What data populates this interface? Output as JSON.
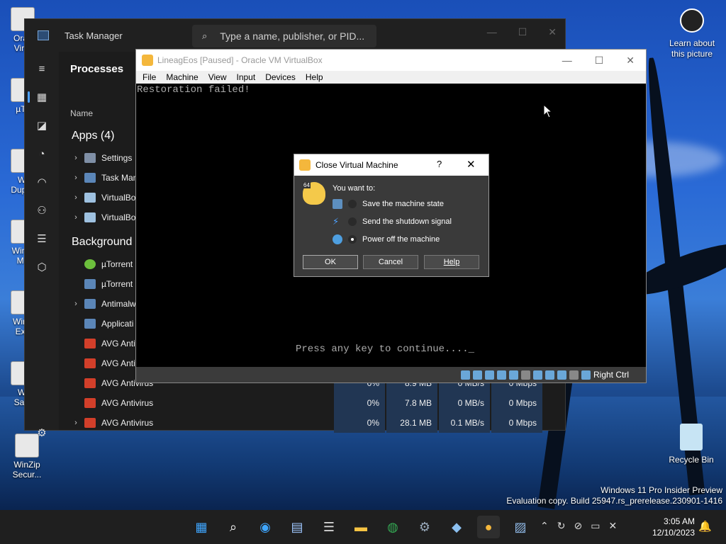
{
  "desktop": {
    "left_icons": [
      {
        "label": "Orac\nVirtu"
      },
      {
        "label": "µTo"
      },
      {
        "label": "Wi\nDuplic"
      },
      {
        "label": "WinZi\nMa"
      },
      {
        "label": "WinZ\nExp"
      },
      {
        "label": "Wi\nSafe"
      },
      {
        "label": "WinZip\nSecur..."
      }
    ],
    "learn_about": "Learn about\nthis picture",
    "recycle_bin": "Recycle Bin",
    "watermark_line1": "Windows 11 Pro Insider Preview",
    "watermark_line2": "Evaluation copy. Build 25947.rs_prerelease.230901-1416"
  },
  "task_manager": {
    "title": "Task Manager",
    "search_placeholder": "Type a name, publisher, or PID...",
    "page_title": "Processes",
    "col_name": "Name",
    "apps_header": "Apps (4)",
    "background_header": "Background p",
    "apps": [
      {
        "name": "Settings",
        "expandable": true
      },
      {
        "name": "Task Man",
        "expandable": true
      },
      {
        "name": "VirtualBox",
        "expandable": true
      },
      {
        "name": "VirtualBox",
        "expandable": true
      }
    ],
    "background": [
      {
        "name": "µTorrent",
        "expandable": false,
        "cpu": "",
        "mem": "",
        "disk": "",
        "net": ""
      },
      {
        "name": "µTorrent",
        "expandable": false,
        "cpu": "",
        "mem": "",
        "disk": "",
        "net": ""
      },
      {
        "name": "Antimalw",
        "expandable": true,
        "cpu": "",
        "mem": "",
        "disk": "",
        "net": ""
      },
      {
        "name": "Applicati",
        "expandable": false,
        "cpu": "",
        "mem": "",
        "disk": "",
        "net": ""
      },
      {
        "name": "AVG Antiv",
        "expandable": false,
        "cpu": "",
        "mem": "",
        "disk": "",
        "net": ""
      },
      {
        "name": "AVG Antiv",
        "expandable": false,
        "cpu": "",
        "mem": "",
        "disk": "",
        "net": ""
      },
      {
        "name": "AVG Antivirus",
        "expandable": false,
        "cpu": "0%",
        "mem": "8.9 MB",
        "disk": "0 MB/s",
        "net": "0 Mbps"
      },
      {
        "name": "AVG Antivirus",
        "expandable": false,
        "cpu": "0%",
        "mem": "7.8 MB",
        "disk": "0 MB/s",
        "net": "0 Mbps"
      },
      {
        "name": "AVG Antivirus",
        "expandable": true,
        "cpu": "0%",
        "mem": "28.1 MB",
        "disk": "0.1 MB/s",
        "net": "0 Mbps"
      }
    ]
  },
  "virtualbox": {
    "title": "LineagEos [Paused] - Oracle VM VirtualBox",
    "menu": [
      "File",
      "Machine",
      "View",
      "Input",
      "Devices",
      "Help"
    ],
    "screen_line1": "Restoration failed!",
    "screen_line2": "Press any key to continue...._",
    "host_key": "Right Ctrl"
  },
  "dialog": {
    "title": "Close Virtual Machine",
    "help_glyph": "?",
    "close_glyph": "✕",
    "badge": "64",
    "prompt": "You want to:",
    "options": [
      {
        "label": "Save the machine state",
        "selected": false
      },
      {
        "label": "Send the shutdown signal",
        "selected": false
      },
      {
        "label": "Power off the machine",
        "selected": true
      }
    ],
    "ok": "OK",
    "cancel": "Cancel",
    "help": "Help"
  },
  "taskbar": {
    "time": "3:05 AM",
    "date": "12/10/2023"
  }
}
